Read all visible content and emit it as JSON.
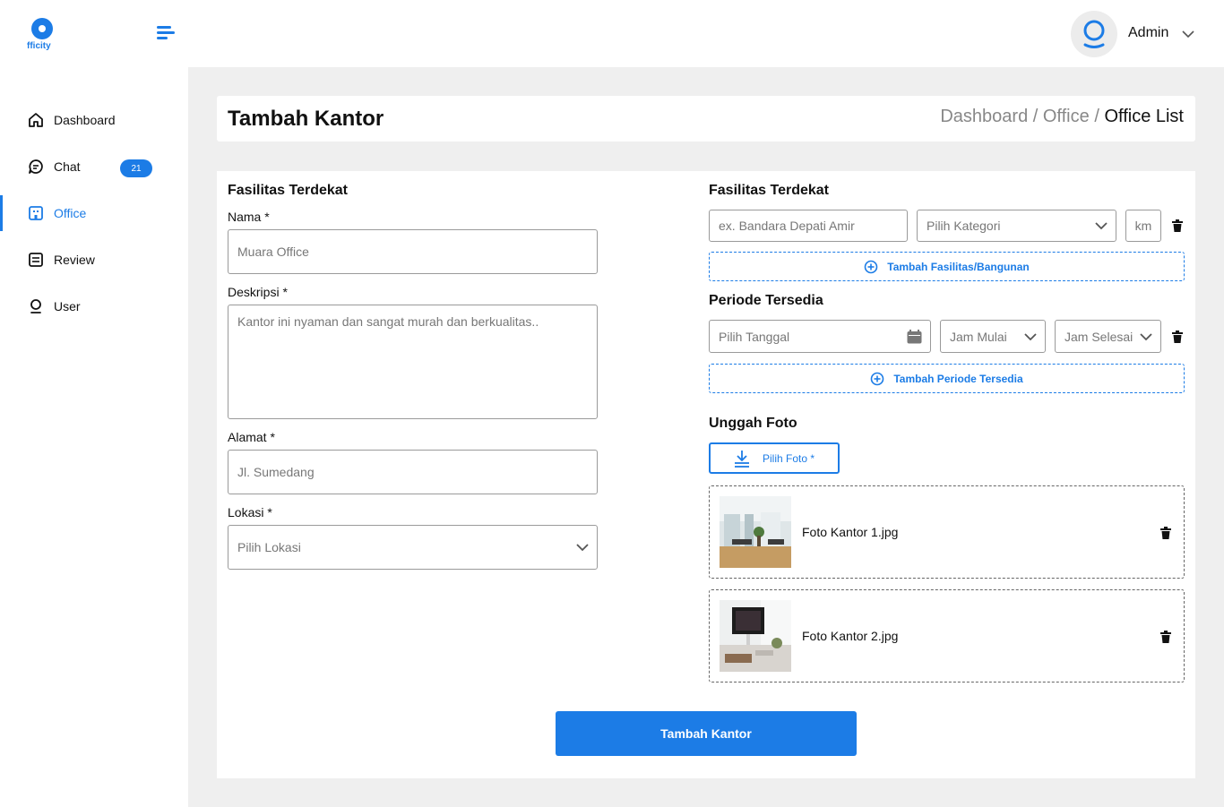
{
  "brand": {
    "logo_text": "fficity",
    "accent": "#1c7ce6"
  },
  "sidebar": {
    "items": [
      {
        "label": "Dashboard",
        "icon": "home-icon",
        "active": false
      },
      {
        "label": "Chat",
        "icon": "chat-icon",
        "badge": "21",
        "active": false
      },
      {
        "label": "Office",
        "icon": "office-icon",
        "active": true
      },
      {
        "label": "Review",
        "icon": "review-icon",
        "active": false
      },
      {
        "label": "User",
        "icon": "user-icon",
        "active": false
      }
    ]
  },
  "header": {
    "user_name": "Admin"
  },
  "page": {
    "title": "Tambah Kantor",
    "breadcrumb": {
      "item1": "Dashboard",
      "sep": "/",
      "item2": "Office",
      "current": "Office List"
    }
  },
  "left_form": {
    "section_title": "Fasilitas Terdekat",
    "name_label": "Nama *",
    "name_placeholder": "Muara Office",
    "desc_label": "Deskripsi *",
    "desc_placeholder": "Kantor ini nyaman dan sangat murah dan berkualitas..",
    "address_label": "Alamat *",
    "address_placeholder": "Jl. Sumedang",
    "location_label": "Lokasi *",
    "location_placeholder": "Pilih Lokasi"
  },
  "facilities": {
    "section_title": "Fasilitas Terdekat",
    "name_placeholder": "ex. Bandara Depati Amir",
    "category_placeholder": "Pilih Kategori",
    "distance_placeholder": "km",
    "add_label": "Tambah Fasilitas/Bangunan"
  },
  "period": {
    "section_title": "Periode Tersedia",
    "date_placeholder": "Pilih Tanggal",
    "start_placeholder": "Jam Mulai",
    "end_placeholder": "Jam Selesai",
    "add_label": "Tambah Periode Tersedia"
  },
  "photos": {
    "section_title": "Unggah Foto",
    "upload_label": "Pilih Foto *",
    "files": [
      {
        "name": "Foto Kantor 1.jpg"
      },
      {
        "name": "Foto Kantor 2.jpg"
      }
    ]
  },
  "submit_label": "Tambah Kantor"
}
